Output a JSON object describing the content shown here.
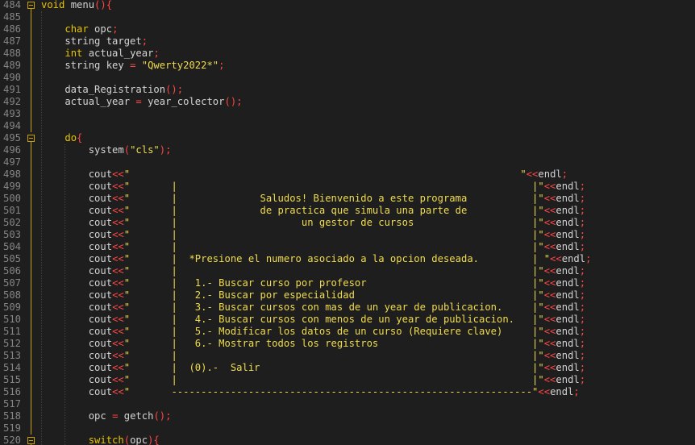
{
  "editor": {
    "theme": {
      "background": "#1e1e1e",
      "line_number": "#858585",
      "default_text": "#d4d4d4",
      "keyword": "#e8c300",
      "string": "#f0dc4e",
      "operator": "#ff4646",
      "fold_marker": "#c8a000"
    },
    "lines": [
      {
        "num": "484",
        "fold": "open",
        "tokens": [
          [
            "kw",
            "void"
          ],
          [
            "plain",
            " menu"
          ],
          [
            "op",
            "(){"
          ]
        ]
      },
      {
        "num": "485",
        "tokens": []
      },
      {
        "num": "486",
        "tokens": [
          [
            "plain",
            "    "
          ],
          [
            "kw",
            "char"
          ],
          [
            "plain",
            " opc"
          ],
          [
            "op",
            ";"
          ]
        ]
      },
      {
        "num": "487",
        "tokens": [
          [
            "plain",
            "    string target"
          ],
          [
            "op",
            ";"
          ]
        ]
      },
      {
        "num": "488",
        "tokens": [
          [
            "plain",
            "    "
          ],
          [
            "kw",
            "int"
          ],
          [
            "plain",
            " actual_year"
          ],
          [
            "op",
            ";"
          ]
        ]
      },
      {
        "num": "489",
        "tokens": [
          [
            "plain",
            "    string key "
          ],
          [
            "op",
            "="
          ],
          [
            "plain",
            " "
          ],
          [
            "str",
            "\"Qwerty2022*\""
          ],
          [
            "op",
            ";"
          ]
        ]
      },
      {
        "num": "490",
        "tokens": []
      },
      {
        "num": "491",
        "tokens": [
          [
            "plain",
            "    data_Registration"
          ],
          [
            "op",
            "();"
          ]
        ]
      },
      {
        "num": "492",
        "tokens": [
          [
            "plain",
            "    actual_year "
          ],
          [
            "op",
            "="
          ],
          [
            "plain",
            " year_colector"
          ],
          [
            "op",
            "();"
          ]
        ]
      },
      {
        "num": "493",
        "tokens": []
      },
      {
        "num": "494",
        "tokens": []
      },
      {
        "num": "495",
        "fold": "open",
        "tokens": [
          [
            "plain",
            "    "
          ],
          [
            "kw",
            "do"
          ],
          [
            "op",
            "{"
          ]
        ]
      },
      {
        "num": "496",
        "tokens": [
          [
            "plain",
            "        system"
          ],
          [
            "op",
            "("
          ],
          [
            "str",
            "\"cls\""
          ],
          [
            "op",
            ");"
          ]
        ]
      },
      {
        "num": "497",
        "tokens": []
      },
      {
        "num": "498",
        "tokens": [
          [
            "plain",
            "        cout"
          ],
          [
            "op",
            "<<"
          ],
          [
            "str",
            "\"                                                                  \""
          ],
          [
            "op",
            "<<"
          ],
          [
            "plain",
            "endl"
          ],
          [
            "op",
            ";"
          ]
        ]
      },
      {
        "num": "499",
        "tokens": [
          [
            "plain",
            "        cout"
          ],
          [
            "op",
            "<<"
          ],
          [
            "str",
            "\"       |                                                            |\""
          ],
          [
            "op",
            "<<"
          ],
          [
            "plain",
            "endl"
          ],
          [
            "op",
            ";"
          ]
        ]
      },
      {
        "num": "500",
        "tokens": [
          [
            "plain",
            "        cout"
          ],
          [
            "op",
            "<<"
          ],
          [
            "str",
            "\"       |              Saludos! Bienvenido a este programa           |\""
          ],
          [
            "op",
            "<<"
          ],
          [
            "plain",
            "endl"
          ],
          [
            "op",
            ";"
          ]
        ]
      },
      {
        "num": "501",
        "tokens": [
          [
            "plain",
            "        cout"
          ],
          [
            "op",
            "<<"
          ],
          [
            "str",
            "\"       |              de practica que simula una parte de           |\""
          ],
          [
            "op",
            "<<"
          ],
          [
            "plain",
            "endl"
          ],
          [
            "op",
            ";"
          ]
        ]
      },
      {
        "num": "502",
        "tokens": [
          [
            "plain",
            "        cout"
          ],
          [
            "op",
            "<<"
          ],
          [
            "str",
            "\"       |                     un gestor de cursos                    |\""
          ],
          [
            "op",
            "<<"
          ],
          [
            "plain",
            "endl"
          ],
          [
            "op",
            ";"
          ]
        ]
      },
      {
        "num": "503",
        "tokens": [
          [
            "plain",
            "        cout"
          ],
          [
            "op",
            "<<"
          ],
          [
            "str",
            "\"       |                                                            |\""
          ],
          [
            "op",
            "<<"
          ],
          [
            "plain",
            "endl"
          ],
          [
            "op",
            ";"
          ]
        ]
      },
      {
        "num": "504",
        "tokens": [
          [
            "plain",
            "        cout"
          ],
          [
            "op",
            "<<"
          ],
          [
            "str",
            "\"       |                                                            |\""
          ],
          [
            "op",
            "<<"
          ],
          [
            "plain",
            "endl"
          ],
          [
            "op",
            ";"
          ]
        ]
      },
      {
        "num": "505",
        "tokens": [
          [
            "plain",
            "        cout"
          ],
          [
            "op",
            "<<"
          ],
          [
            "str",
            "\"       |  *Presione el numero asociado a la opcion deseada.         | \""
          ],
          [
            "op",
            "<<"
          ],
          [
            "plain",
            "endl"
          ],
          [
            "op",
            ";"
          ]
        ]
      },
      {
        "num": "506",
        "tokens": [
          [
            "plain",
            "        cout"
          ],
          [
            "op",
            "<<"
          ],
          [
            "str",
            "\"       |                                                            |\""
          ],
          [
            "op",
            "<<"
          ],
          [
            "plain",
            "endl"
          ],
          [
            "op",
            ";"
          ]
        ]
      },
      {
        "num": "507",
        "tokens": [
          [
            "plain",
            "        cout"
          ],
          [
            "op",
            "<<"
          ],
          [
            "str",
            "\"       |   1.- Buscar curso por profesor                            |\""
          ],
          [
            "op",
            "<<"
          ],
          [
            "plain",
            "endl"
          ],
          [
            "op",
            ";"
          ]
        ]
      },
      {
        "num": "508",
        "tokens": [
          [
            "plain",
            "        cout"
          ],
          [
            "op",
            "<<"
          ],
          [
            "str",
            "\"       |   2.- Buscar por especialidad                              |\""
          ],
          [
            "op",
            "<<"
          ],
          [
            "plain",
            "endl"
          ],
          [
            "op",
            ";"
          ]
        ]
      },
      {
        "num": "509",
        "tokens": [
          [
            "plain",
            "        cout"
          ],
          [
            "op",
            "<<"
          ],
          [
            "str",
            "\"       |   3.- Buscar cursos con mas de un year de publicacion.     |\""
          ],
          [
            "op",
            "<<"
          ],
          [
            "plain",
            "endl"
          ],
          [
            "op",
            ";"
          ]
        ]
      },
      {
        "num": "510",
        "tokens": [
          [
            "plain",
            "        cout"
          ],
          [
            "op",
            "<<"
          ],
          [
            "str",
            "\"       |   4.- Buscar cursos con menos de un year de publicacion.   |\""
          ],
          [
            "op",
            "<<"
          ],
          [
            "plain",
            "endl"
          ],
          [
            "op",
            ";"
          ]
        ]
      },
      {
        "num": "511",
        "tokens": [
          [
            "plain",
            "        cout"
          ],
          [
            "op",
            "<<"
          ],
          [
            "str",
            "\"       |   5.- Modificar los datos de un curso (Requiere clave)     |\""
          ],
          [
            "op",
            "<<"
          ],
          [
            "plain",
            "endl"
          ],
          [
            "op",
            ";"
          ]
        ]
      },
      {
        "num": "512",
        "tokens": [
          [
            "plain",
            "        cout"
          ],
          [
            "op",
            "<<"
          ],
          [
            "str",
            "\"       |   6.- Mostrar todos los registros                          |\""
          ],
          [
            "op",
            "<<"
          ],
          [
            "plain",
            "endl"
          ],
          [
            "op",
            ";"
          ]
        ]
      },
      {
        "num": "513",
        "tokens": [
          [
            "plain",
            "        cout"
          ],
          [
            "op",
            "<<"
          ],
          [
            "str",
            "\"       |                                                            |\""
          ],
          [
            "op",
            "<<"
          ],
          [
            "plain",
            "endl"
          ],
          [
            "op",
            ";"
          ]
        ]
      },
      {
        "num": "514",
        "tokens": [
          [
            "plain",
            "        cout"
          ],
          [
            "op",
            "<<"
          ],
          [
            "str",
            "\"       |  (0).-  Salir                                              |\""
          ],
          [
            "op",
            "<<"
          ],
          [
            "plain",
            "endl"
          ],
          [
            "op",
            ";"
          ]
        ]
      },
      {
        "num": "515",
        "tokens": [
          [
            "plain",
            "        cout"
          ],
          [
            "op",
            "<<"
          ],
          [
            "str",
            "\"       |                                                            |\""
          ],
          [
            "op",
            "<<"
          ],
          [
            "plain",
            "endl"
          ],
          [
            "op",
            ";"
          ]
        ]
      },
      {
        "num": "516",
        "tokens": [
          [
            "plain",
            "        cout"
          ],
          [
            "op",
            "<<"
          ],
          [
            "str",
            "\"       -------------------------------------------------------------\""
          ],
          [
            "op",
            "<<"
          ],
          [
            "plain",
            "endl"
          ],
          [
            "op",
            ";"
          ]
        ]
      },
      {
        "num": "517",
        "tokens": []
      },
      {
        "num": "518",
        "tokens": [
          [
            "plain",
            "        opc "
          ],
          [
            "op",
            "="
          ],
          [
            "plain",
            " getch"
          ],
          [
            "op",
            "();"
          ]
        ]
      },
      {
        "num": "519",
        "tokens": []
      },
      {
        "num": "520",
        "fold": "open",
        "tokens": [
          [
            "plain",
            "        "
          ],
          [
            "kw",
            "switch"
          ],
          [
            "op",
            "("
          ],
          [
            "plain",
            "opc"
          ],
          [
            "op",
            "){"
          ]
        ]
      }
    ]
  }
}
